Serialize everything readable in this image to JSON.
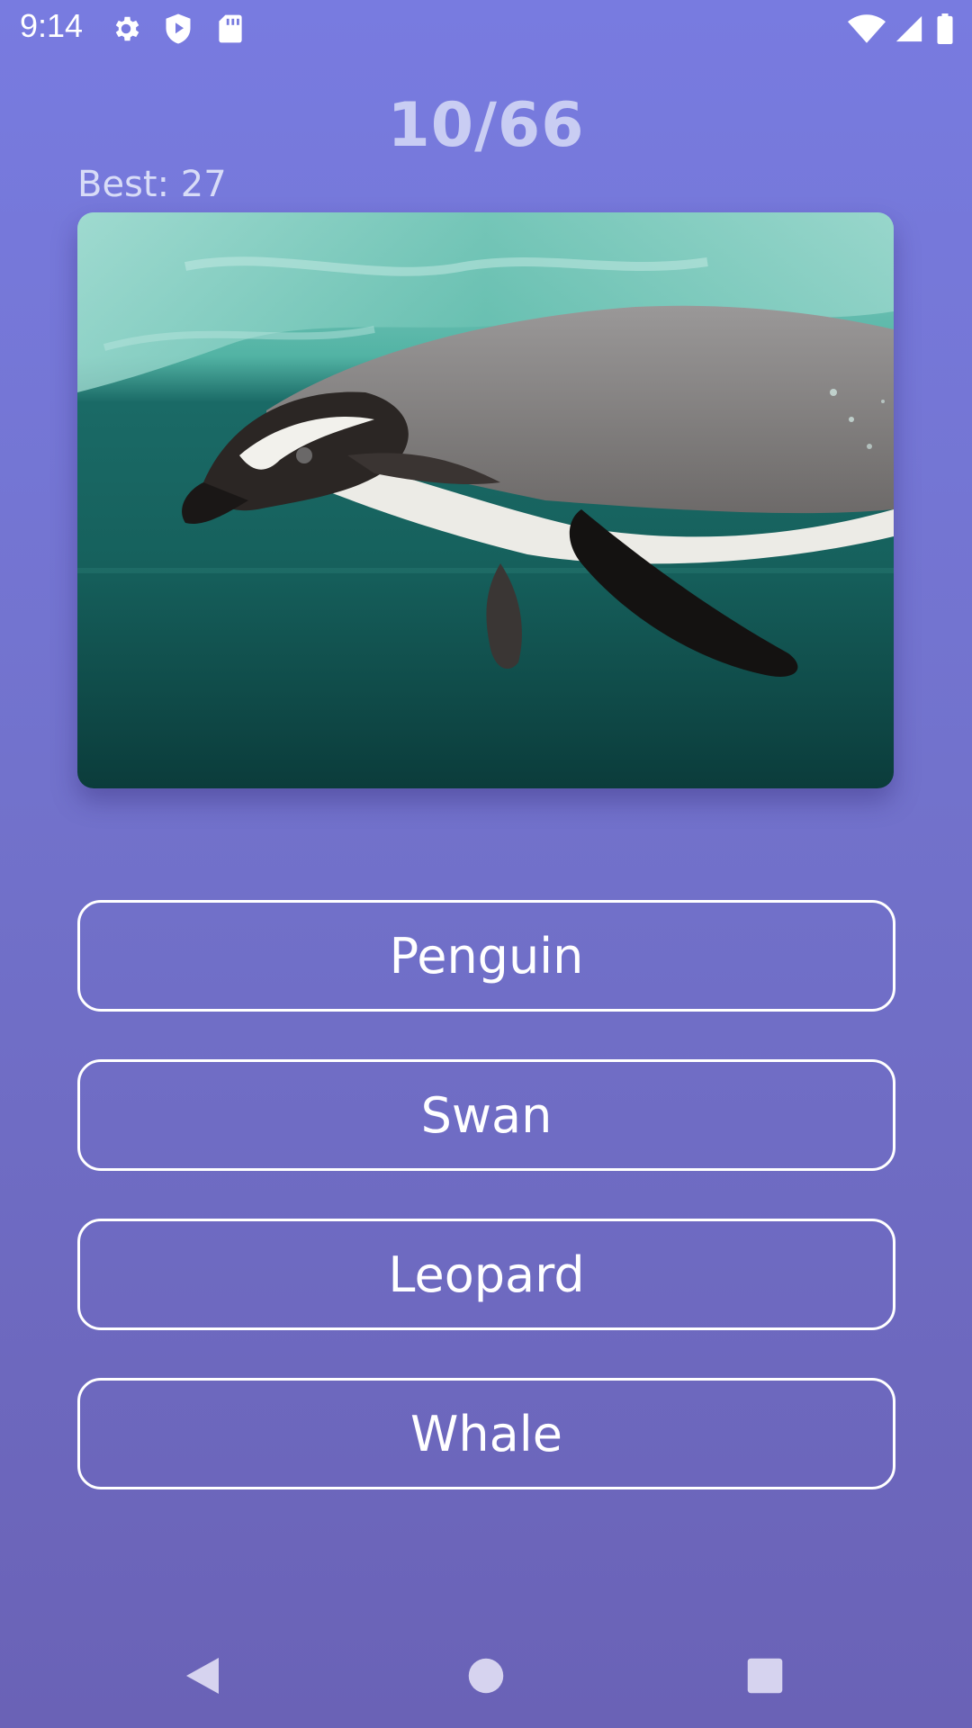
{
  "status_bar": {
    "time": "9:14",
    "icons": [
      "gear-icon",
      "shield-play-icon",
      "sd-card-icon",
      "wifi-icon",
      "signal-icon",
      "battery-icon"
    ]
  },
  "quiz": {
    "progress": "10/66",
    "best": "Best: 27",
    "image": "penguin-swimming-photo",
    "answers": [
      {
        "label": "Penguin"
      },
      {
        "label": "Swan"
      },
      {
        "label": "Leopard"
      },
      {
        "label": "Whale"
      }
    ]
  },
  "nav_bar": {
    "icons": [
      "back-icon",
      "home-icon",
      "recents-icon"
    ]
  },
  "colors": {
    "background_top": "#787be0",
    "background_bottom": "#6a62b6",
    "score_text": "#c9cdf3",
    "button_border": "#ffffff"
  }
}
